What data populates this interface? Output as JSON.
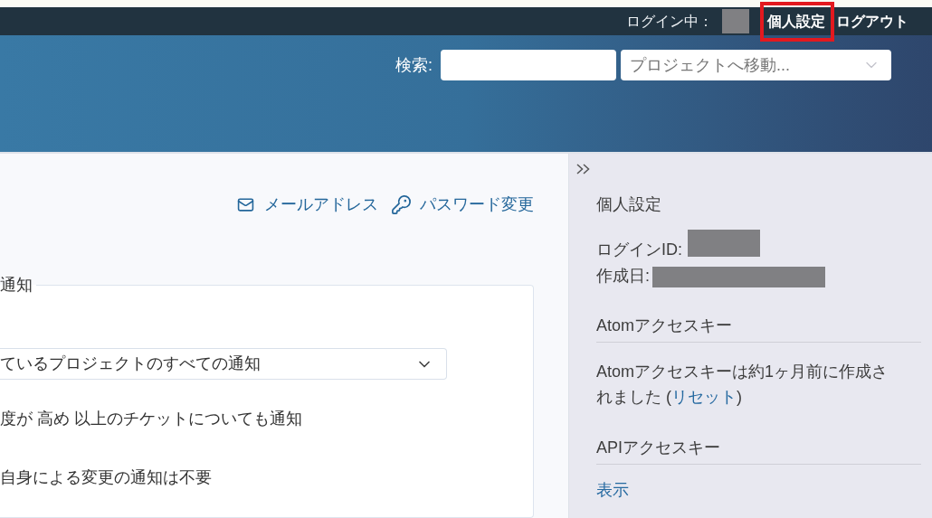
{
  "top_bar": {
    "login_label": "ログイン中：",
    "user_redacted": true,
    "links": [
      {
        "label": "個人設定",
        "highlighted": true
      },
      {
        "label": "ログアウト",
        "highlighted": false
      }
    ]
  },
  "header": {
    "search": {
      "label": "検索:"
    },
    "project_jump": {
      "placeholder": "プロジェクトへ移動..."
    }
  },
  "main": {
    "actions": [
      {
        "kind": "mail",
        "label": "メールアドレス"
      },
      {
        "kind": "key",
        "label": "パスワード変更"
      }
    ],
    "notifications": {
      "legend": "通知",
      "select": {
        "value": "ているプロジェクトのすべての通知"
      },
      "options": [
        {
          "label": "度が 高め 以上のチケットについても通知"
        },
        {
          "label": "自身による変更の通知は不要"
        }
      ]
    }
  },
  "sidebar": {
    "title": "個人設定",
    "fields": [
      {
        "label": "ログインID:",
        "redacted": true
      },
      {
        "label": "作成日:",
        "redacted": true
      }
    ],
    "sections": [
      {
        "kind": "note",
        "title": "Atomアクセスキー",
        "text": "Atomアクセスキーは約1ヶ月前に作成されました (",
        "link": "リセット",
        "text_after": ")"
      },
      {
        "kind": "link",
        "title": "APIアクセスキー",
        "link": "表示"
      }
    ]
  }
}
